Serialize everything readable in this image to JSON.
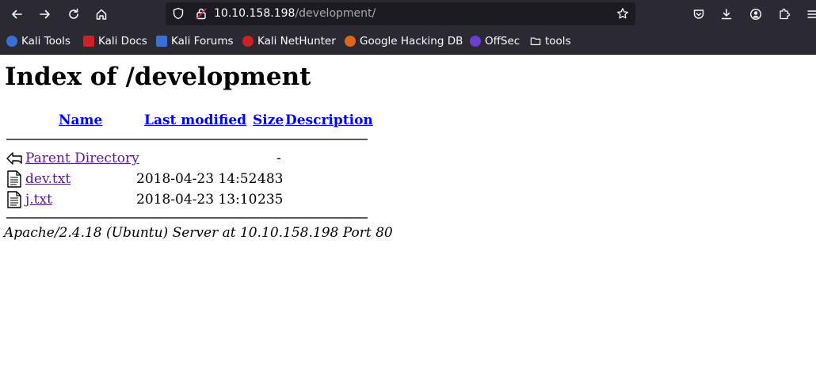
{
  "browser": {
    "url_host": "10.10.158.198",
    "url_path": "/development/",
    "bookmarks": [
      {
        "label": "Kali Tools",
        "icon": "kali-tools-icon",
        "color": "#3b6fd8"
      },
      {
        "label": "Kali Docs",
        "icon": "kali-docs-icon",
        "color": "#cc2127"
      },
      {
        "label": "Kali Forums",
        "icon": "kali-forums-icon",
        "color": "#3b6fd8"
      },
      {
        "label": "Kali NetHunter",
        "icon": "kali-nethunter-icon",
        "color": "#cc2127"
      },
      {
        "label": "Google Hacking DB",
        "icon": "exploit-db-icon",
        "color": "#e0631e"
      },
      {
        "label": "OffSec",
        "icon": "offsec-icon",
        "color": "#6a3fd0"
      },
      {
        "label": "tools",
        "icon": "folder-icon",
        "color": "#fbfbfe"
      }
    ]
  },
  "page": {
    "title": "Index of /development",
    "headers": {
      "name": "Name",
      "last_modified": "Last modified",
      "size": "Size",
      "description": "Description"
    },
    "rows": [
      {
        "name": "Parent Directory",
        "modified": "",
        "size": "-",
        "description": "",
        "icon": "back-icon"
      },
      {
        "name": "dev.txt",
        "modified": "2018-04-23 14:52",
        "size": "483",
        "description": "",
        "icon": "text-file-icon"
      },
      {
        "name": "j.txt",
        "modified": "2018-04-23 13:10",
        "size": "235",
        "description": "",
        "icon": "text-file-icon"
      }
    ],
    "address": "Apache/2.4.18 (Ubuntu) Server at 10.10.158.198 Port 80"
  },
  "colors": {
    "toolbar_bg": "#2b2a33",
    "urlbar_bg": "#1c1b22",
    "link": "#0000ee",
    "visited_link": "#551a8b"
  }
}
